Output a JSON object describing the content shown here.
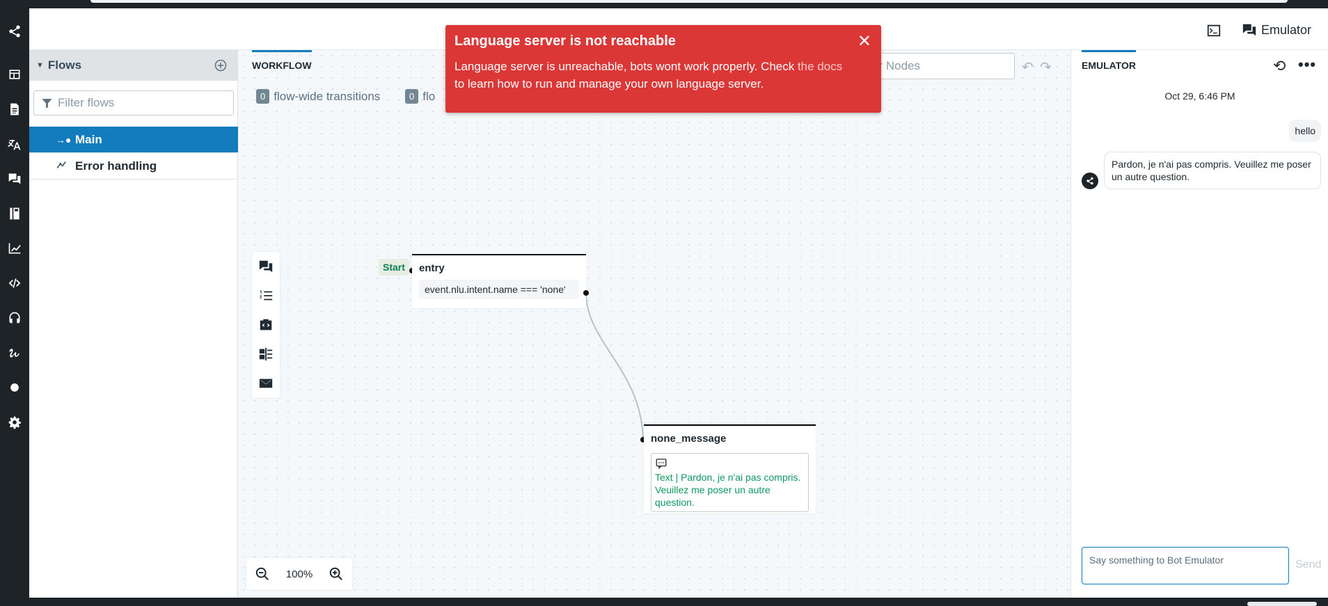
{
  "header": {
    "emulator_button_label": "Emulator"
  },
  "nav": {
    "items": [
      "share-logo-icon",
      "dashboard-icon",
      "content-icon",
      "translate-icon",
      "qna-icon",
      "library-icon",
      "analytics-icon",
      "code-editor-icon",
      "hitl-headset-icon",
      "nlu-icon",
      "status-dot-icon",
      "settings-gear-icon"
    ]
  },
  "sidebar": {
    "title": "Flows",
    "filter_placeholder": "Filter flows",
    "flows": [
      {
        "label": "Main",
        "active": true
      },
      {
        "label": "Error handling",
        "active": false
      }
    ]
  },
  "canvas": {
    "tab_label": "WORKFLOW",
    "counters": [
      {
        "count": "0",
        "label": "flow-wide transitions"
      },
      {
        "count": "0",
        "label": "flo"
      }
    ],
    "filter_nodes_placeholder": "er Nodes",
    "zoom_level": "100%",
    "start_label": "Start",
    "nodes": {
      "entry": {
        "name": "entry",
        "condition": "event.nlu.intent.name === 'none'"
      },
      "none_message": {
        "name": "none_message",
        "message": "Text | Pardon, je n'ai pas compris. Veuillez me poser un autre question."
      }
    }
  },
  "toast": {
    "title": "Language server is not reachable",
    "body_before_link": "Language server is unreachable, bots wont work properly. Check ",
    "link": "the docs",
    "body_after_link": " to learn how to run and manage your own language server.",
    "background": "#db3737"
  },
  "emulator": {
    "tab_label": "EMULATOR",
    "date": "Oct 29, 6:46 PM",
    "user_message": "hello",
    "bot_message": "Pardon, je n'ai pas compris. Veuillez me poser un autre question.",
    "input_placeholder": "Say something to Bot Emulator",
    "send_label": "Send"
  },
  "colors": {
    "accent": "#137cbd",
    "nav_bg": "#1e2327",
    "success_text": "#0f9960",
    "danger": "#db3737"
  }
}
